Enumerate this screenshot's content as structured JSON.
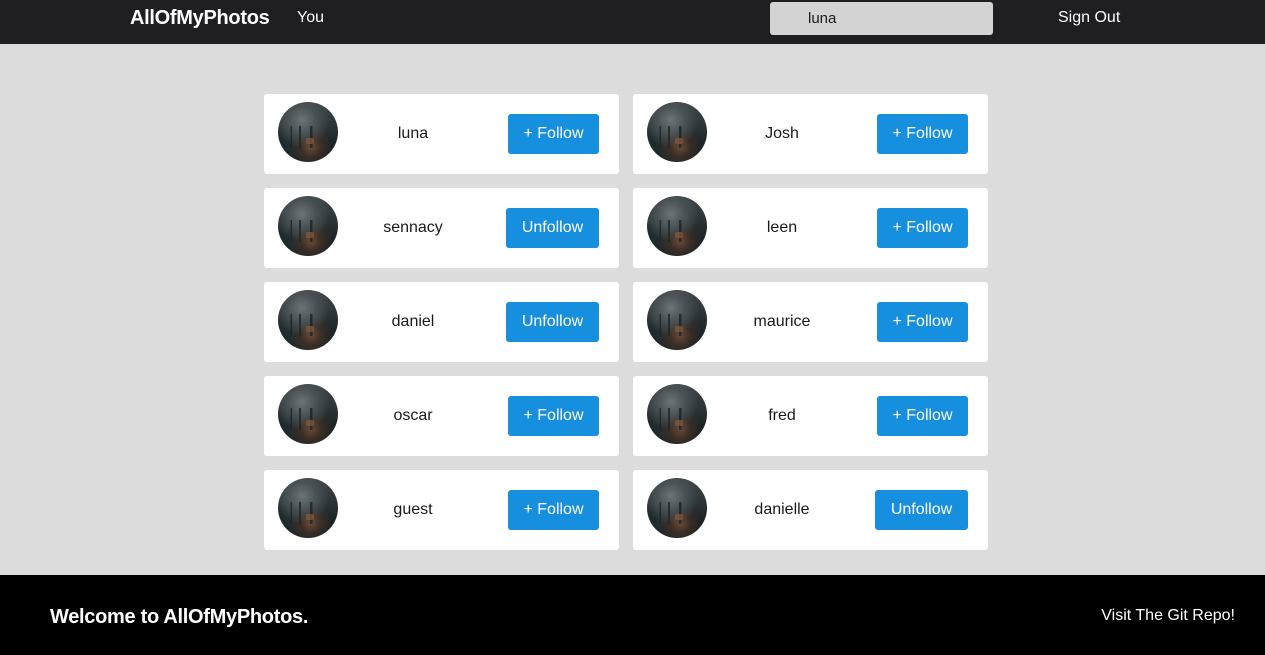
{
  "navbar": {
    "brand": "AllOfMyPhotos",
    "you_label": "You",
    "search_value": "luna",
    "sign_out_label": "Sign Out"
  },
  "users": [
    {
      "name": "luna",
      "action": "+ Follow",
      "following": false
    },
    {
      "name": "Josh",
      "action": "+ Follow",
      "following": false
    },
    {
      "name": "sennacy",
      "action": "Unfollow",
      "following": true
    },
    {
      "name": "leen",
      "action": "+ Follow",
      "following": false
    },
    {
      "name": "daniel",
      "action": "Unfollow",
      "following": true
    },
    {
      "name": "maurice",
      "action": "+ Follow",
      "following": false
    },
    {
      "name": "oscar",
      "action": "+ Follow",
      "following": false
    },
    {
      "name": "fred",
      "action": "+ Follow",
      "following": false
    },
    {
      "name": "guest",
      "action": "+ Follow",
      "following": false
    },
    {
      "name": "danielle",
      "action": "Unfollow",
      "following": true
    }
  ],
  "footer": {
    "welcome": "Welcome to AllOfMyPhotos.",
    "repo_link": "Visit The Git Repo!"
  },
  "colors": {
    "navbar_bg": "#1f1f21",
    "page_bg": "#dcdcdc",
    "button_bg": "#178fdf",
    "footer_bg": "#000000"
  }
}
